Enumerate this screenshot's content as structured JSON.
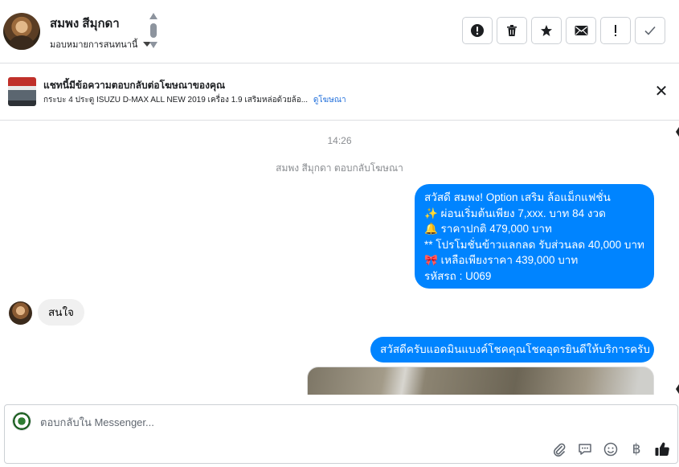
{
  "header": {
    "contact_name": "สมพง สีมุกดา",
    "assign_label": "มอบหมายการสนทนานี้",
    "actions": [
      {
        "name": "mark-spam-button",
        "icon": "alert-circle-icon",
        "glyph": "!"
      },
      {
        "name": "delete-button",
        "icon": "trash-icon",
        "glyph": ""
      },
      {
        "name": "star-button",
        "icon": "star-icon",
        "glyph": "★"
      },
      {
        "name": "mark-unread-button",
        "icon": "envelope-icon",
        "glyph": ""
      },
      {
        "name": "follow-up-button",
        "icon": "exclamation-icon",
        "glyph": "!"
      },
      {
        "name": "mark-done-button",
        "icon": "checkmark-icon",
        "glyph": "✓"
      }
    ]
  },
  "ad": {
    "title": "แชทนี้มีข้อความตอบกลับต่อโฆษณาของคุณ",
    "description": "กระบะ 4 ประตู ISUZU D-MAX ALL NEW 2019 เครื่อง 1.9 เสริมหล่อด้วยล้อ...",
    "link_label": "ดูโฆษณา"
  },
  "conversation": {
    "timestamp": "14:26",
    "system_message": "สมพง สีมุกดา ตอบกลับโฆษณา",
    "message1_lines": [
      "สวัสดี สมพง! Option เสริม ล้อแม็กแฟชั่น",
      "✨  ผ่อนเริ่มต้นเพียง 7,xxx. บาท 84 งวด",
      "🔔 ราคาปกติ 479,000 บาท",
      "** โปรโมชั่นข้าวแลกลด รับส่วนลด 40,000 บาท",
      "🎀  เหลือเพียงราคา 439,000 บาท",
      " รหัสรถ : U069"
    ],
    "incoming_message": "สนใจ",
    "message2": "สวัสดีครับแอดมินแบงค์โชคคุณโชคอุดรยินดีให้บริการครับ"
  },
  "composer": {
    "placeholder": "ตอบกลับใน Messenger...",
    "tools": [
      "paperclip-icon",
      "saved-reply-icon",
      "emoji-icon",
      "baht-icon",
      "thumbs-up-icon"
    ]
  },
  "colors": {
    "outgoing_bubble": "#0084ff",
    "incoming_bubble": "#f0f0f0",
    "link": "#216fdb"
  }
}
